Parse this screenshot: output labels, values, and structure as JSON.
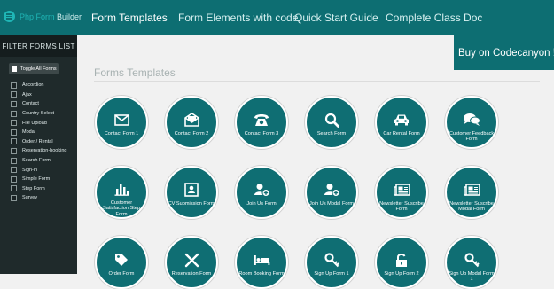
{
  "header": {
    "logo_text_a": "Php Form",
    "logo_text_b": "Builder",
    "nav": [
      {
        "label": "Form Templates"
      },
      {
        "label": "Form Elements with code"
      },
      {
        "label": "Quick Start Guide"
      },
      {
        "label": "Complete Class Doc"
      }
    ]
  },
  "sidebar": {
    "title": "FILTER FORMS LIST",
    "toggle_label": "Toggle All Forms",
    "filters": [
      "Accordion",
      "Ajax",
      "Contact",
      "Country Select",
      "File Upload",
      "Modal",
      "Order / Rental",
      "Reservation-booking",
      "Search Form",
      "Sign-in",
      "Simple Form",
      "Step Form",
      "Survey"
    ]
  },
  "buy": {
    "label": "Buy on Codecanyon !",
    "icon": "share-icon"
  },
  "main": {
    "heading": "Forms Templates",
    "cards": [
      {
        "label": "Contact Form 1",
        "icon": "envelope-icon"
      },
      {
        "label": "Contact Form 2",
        "icon": "envelope-open-icon"
      },
      {
        "label": "Contact Form 3",
        "icon": "telephone-icon"
      },
      {
        "label": "Search Form",
        "icon": "search-icon"
      },
      {
        "label": "Car Rental Form",
        "icon": "car-icon"
      },
      {
        "label": "Customer Feedback Form",
        "icon": "comments-icon"
      },
      {
        "label": "Customer Satisfaction Step Form",
        "icon": "bar-chart-icon"
      },
      {
        "label": "CV Submission Form",
        "icon": "id-card-icon"
      },
      {
        "label": "Join Us Form",
        "icon": "user-plus-icon"
      },
      {
        "label": "Join Us Modal Form",
        "icon": "user-plus-icon"
      },
      {
        "label": "Newsletter Suscribe Form",
        "icon": "newspaper-icon"
      },
      {
        "label": "Newsletter Suscribe Modal Form",
        "icon": "newspaper-icon"
      },
      {
        "label": "Order Form",
        "icon": "tag-icon"
      },
      {
        "label": "Reservation Form",
        "icon": "utensils-icon"
      },
      {
        "label": "Room Booking Form",
        "icon": "bed-icon"
      },
      {
        "label": "Sign Up Form 1",
        "icon": "key-icon"
      },
      {
        "label": "Sign Up Form 2",
        "icon": "unlock-icon"
      },
      {
        "label": "Sign Up Modal Form 1",
        "icon": "key-icon"
      }
    ]
  }
}
